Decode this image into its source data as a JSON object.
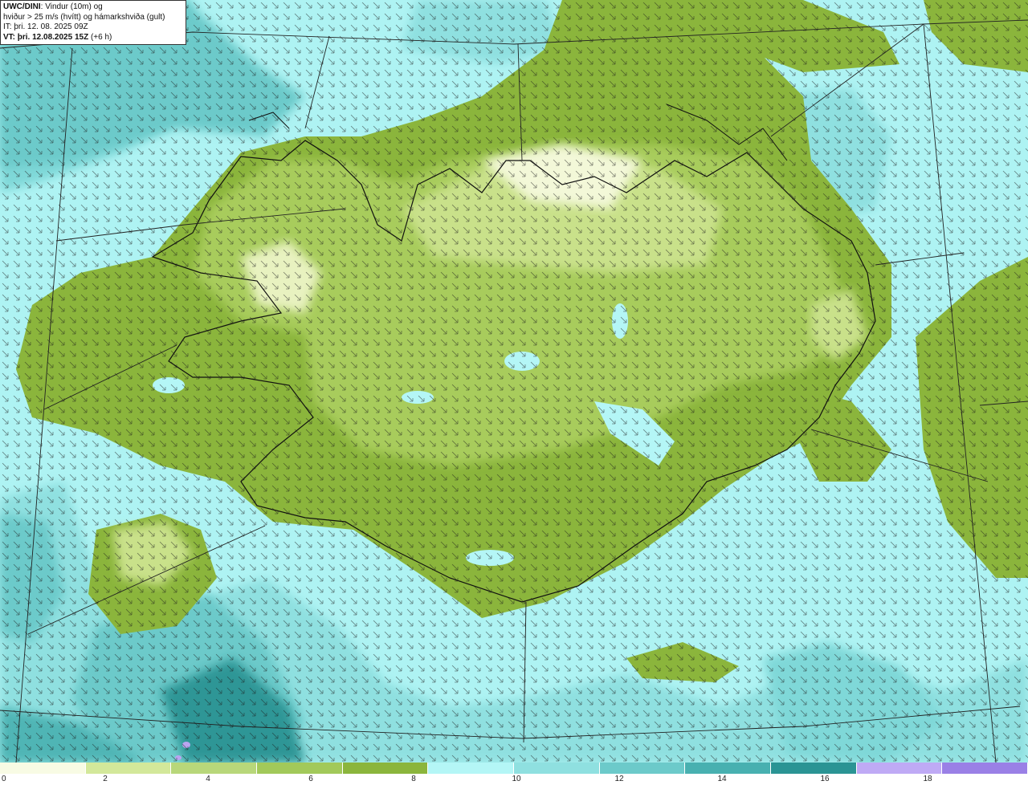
{
  "info": {
    "line1_bold": "UWC/DINI",
    "line1_rest": ": Vindur (10m) og",
    "line2": "hviður > 25 m/s (hvítt) og hámarkshviða (gult)",
    "line3": "IT: þri. 12. 08. 2025 09Z",
    "line4_bold": "VT: þri. 12.08.2025 15Z",
    "line4_rest": " (+6 h)"
  },
  "colors": {
    "ocean_light": "#aef3f3",
    "ocean_mid": "#7fd8d8",
    "ocean_dark": "#4fb5b5",
    "ocean_deep": "#2e9696",
    "land_dark": "#8bb53c",
    "land_mid": "#a8cc5c",
    "land_light": "#c9e18a",
    "land_pale": "#f3f8d8",
    "coast": "#111111",
    "grid": "#222222",
    "purple": "#b9a5f0"
  },
  "colorbar": {
    "swatches": [
      "#f8fbe4",
      "#d3e89a",
      "#b8d77a",
      "#a2c95a",
      "#8bb53c",
      "#b4f6f6",
      "#8fe0e0",
      "#6ccaca",
      "#48b0b0",
      "#2a9494",
      "#bfaaf5",
      "#9a80e6"
    ],
    "ticks": [
      "0",
      "2",
      "4",
      "6",
      "8",
      "10",
      "12",
      "14",
      "16",
      "18"
    ]
  }
}
